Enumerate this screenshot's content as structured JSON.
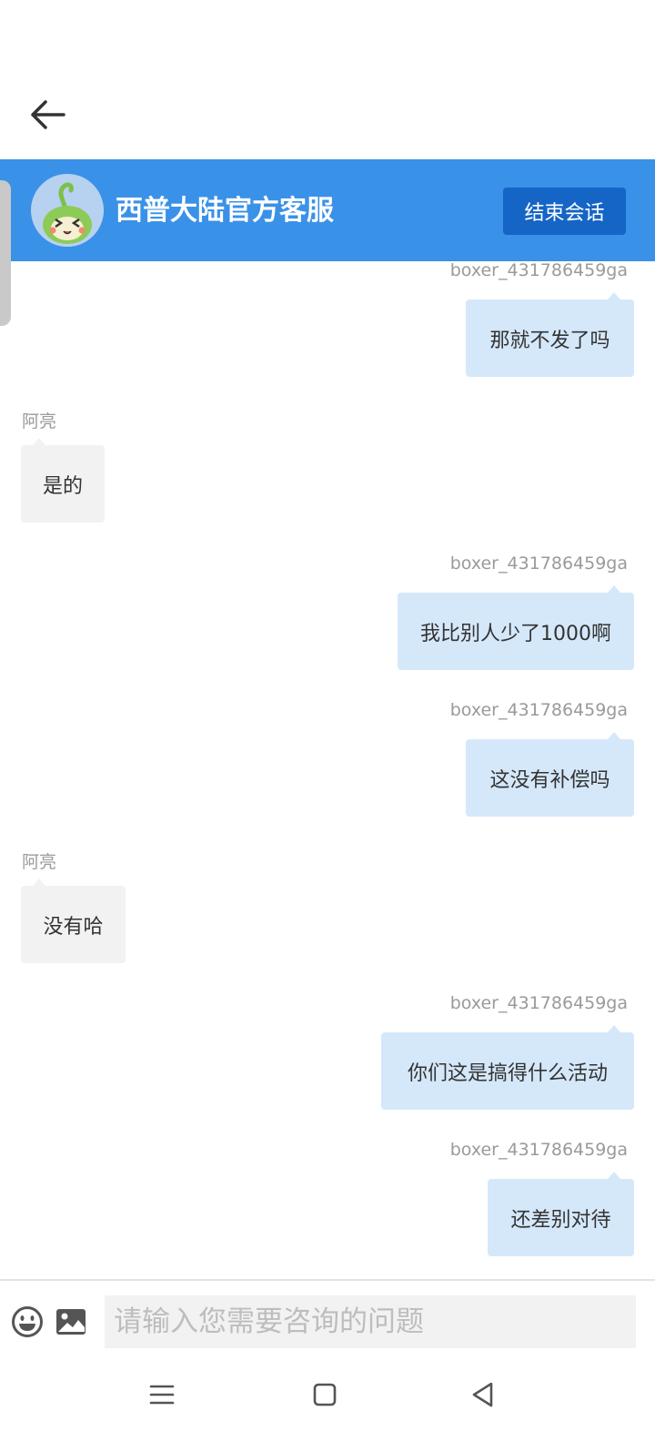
{
  "header": {
    "title": "西普大陆官方客服",
    "end_button": "结束会话"
  },
  "messages": [
    {
      "side": "right",
      "sender": "boxer_431786459ga",
      "text": "那就不发了吗"
    },
    {
      "side": "left",
      "sender": "阿亮",
      "text": "是的"
    },
    {
      "side": "right",
      "sender": "boxer_431786459ga",
      "text": "我比别人少了1000啊"
    },
    {
      "side": "right",
      "sender": "boxer_431786459ga",
      "text": "这没有补偿吗"
    },
    {
      "side": "left",
      "sender": "阿亮",
      "text": "没有哈"
    },
    {
      "side": "right",
      "sender": "boxer_431786459ga",
      "text": "你们这是搞得什么活动"
    },
    {
      "side": "right",
      "sender": "boxer_431786459ga",
      "text": "还差别对待"
    }
  ],
  "input": {
    "placeholder": "请输入您需要咨询的问题"
  },
  "icons": {
    "back": "arrow-left-icon",
    "emoji": "emoji-icon",
    "image": "image-icon",
    "nav_menu": "menu-icon",
    "nav_home": "home-square-icon",
    "nav_back": "back-triangle-icon"
  },
  "colors": {
    "header": "#3a91e8",
    "end_button": "#1565c6",
    "bubble_right": "#d5e8fa",
    "bubble_left": "#f2f2f2"
  }
}
